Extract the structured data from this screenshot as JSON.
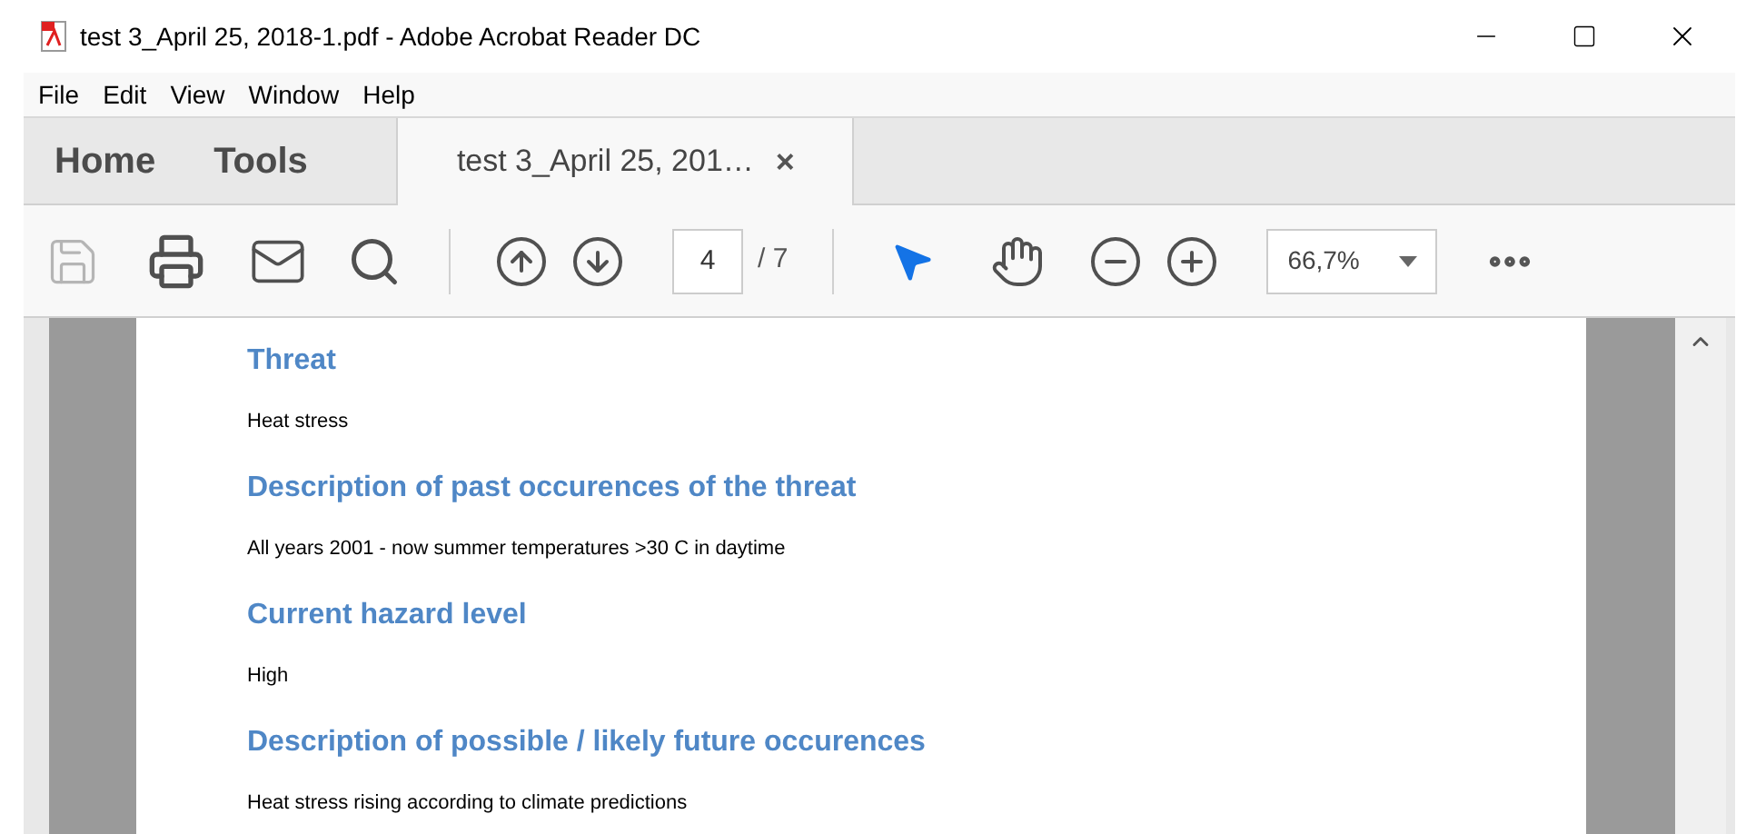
{
  "window": {
    "title": "test 3_April 25, 2018-1.pdf - Adobe Acrobat Reader DC"
  },
  "menu": [
    "File",
    "Edit",
    "View",
    "Window",
    "Help"
  ],
  "tabs": [
    {
      "label": "Home",
      "kind": "nav",
      "selected": false
    },
    {
      "label": "Tools",
      "kind": "nav",
      "selected": false
    },
    {
      "label": "test 3_April 25, 201…",
      "kind": "document",
      "selected": true,
      "close": "×"
    }
  ],
  "toolbar": {
    "save_disabled": true,
    "page": "4",
    "page_total": "/ 7",
    "select_tool_selected": true,
    "zoom": "66,7%"
  },
  "document": {
    "sections": [
      {
        "heading": "Threat",
        "body": "Heat stress"
      },
      {
        "heading": "Description of past occurences of the threat",
        "body": "All years 2001 - now summer temperatures >30 C in daytime"
      },
      {
        "heading": "Current hazard level",
        "body": "High"
      },
      {
        "heading": "Description of possible / likely future occurences",
        "body": "Heat stress rising according to climate predictions"
      }
    ]
  }
}
